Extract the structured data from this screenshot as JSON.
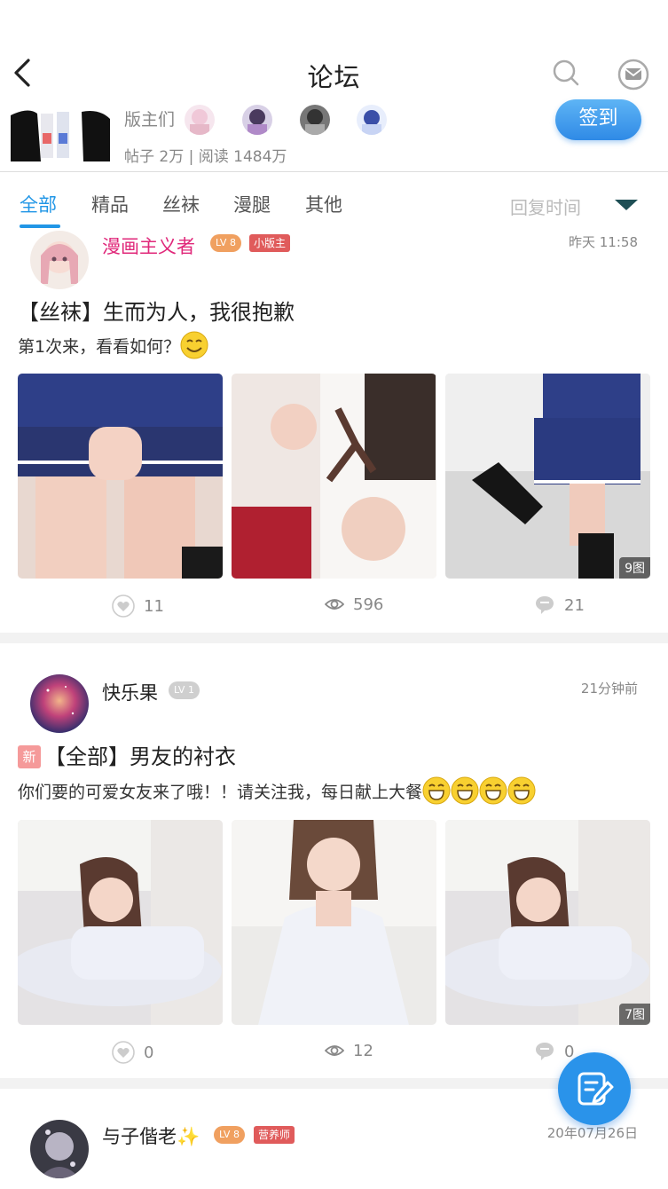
{
  "header": {
    "title": "论坛",
    "back_icon": "chevron-left-icon",
    "search_icon": "search-icon",
    "mail_icon": "mail-icon"
  },
  "forum": {
    "mods_label": "版主们",
    "stats": "帖子 2万 | 阅读 1484万",
    "checkin_label": "签到"
  },
  "tabs": {
    "items": [
      "全部",
      "精品",
      "丝袜",
      "漫腿",
      "其他"
    ],
    "active_index": 0,
    "sort_label": "回复时间",
    "accent_color": "#2196e6"
  },
  "posts": [
    {
      "author": "漫画主义者",
      "author_color": "#e0287a",
      "level": "8",
      "role": "小版主",
      "time": "昨天 11:58",
      "title": "【丝袜】生而为人，我很抱歉",
      "snippet": "第1次来，看看如何？",
      "image_count": "9图",
      "likes": "11",
      "views": "596",
      "comments": "21"
    },
    {
      "author": "快乐果",
      "author_color": "#222222",
      "level": "1",
      "role": "",
      "time": "21分钟前",
      "new_tag": "新",
      "title": "【全部】男友的衬衣",
      "snippet": "你们要的可爱女友来了哦！！请关注我，每日献上大餐",
      "image_count": "7图",
      "likes": "0",
      "views": "12",
      "comments": "0"
    },
    {
      "author": "与子偕老✨",
      "author_color": "#222222",
      "level": "8",
      "role": "营养师",
      "time": "20年07月26日"
    }
  ],
  "fab": {
    "icon": "compose-icon"
  }
}
